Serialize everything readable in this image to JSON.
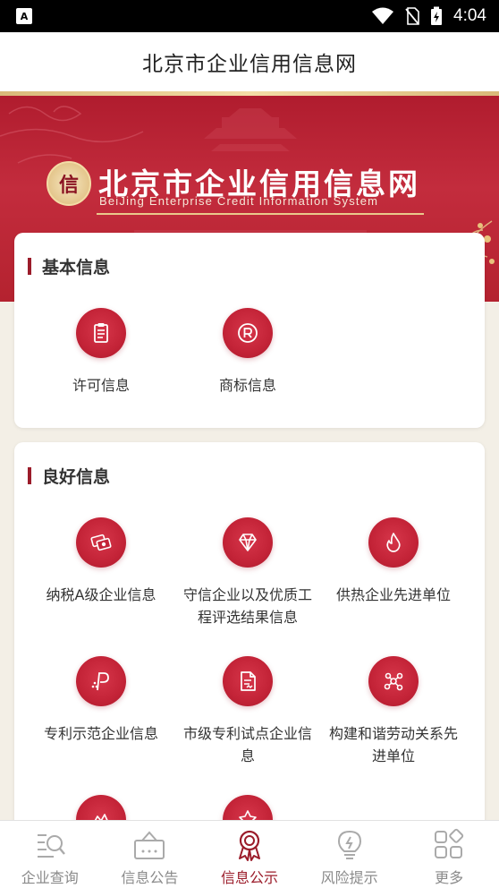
{
  "status_bar": {
    "time": "4:04",
    "notification_icon": "A"
  },
  "header": {
    "title": "北京市企业信用信息网"
  },
  "banner": {
    "seal_char": "信",
    "title": "北京市企业信用信息网",
    "subtitle": "BeiJing Enterprise Credit Information System"
  },
  "basic_info": {
    "title": "基本信息",
    "items": [
      {
        "label": "许可信息",
        "icon": "clipboard-icon"
      },
      {
        "label": "商标信息",
        "icon": "trademark-icon"
      }
    ]
  },
  "good_info": {
    "title": "良好信息",
    "items": [
      {
        "label": "纳税A级企业信息",
        "icon": "tax-icon"
      },
      {
        "label": "守信企业以及优质工程评选结果信息",
        "icon": "diamond-icon"
      },
      {
        "label": "供热企业先进单位",
        "icon": "flame-icon"
      },
      {
        "label": "专利示范企业信息",
        "icon": "patent-icon"
      },
      {
        "label": "市级专利试点企业信息",
        "icon": "document-icon"
      },
      {
        "label": "构建和谐劳动关系先进单位",
        "icon": "network-icon"
      },
      {
        "label": "",
        "icon": "award-icon"
      },
      {
        "label": "",
        "icon": "badge-icon"
      }
    ]
  },
  "bottom_nav": {
    "items": [
      {
        "label": "企业查询",
        "icon": "search-icon"
      },
      {
        "label": "信息公告",
        "icon": "bulletin-icon"
      },
      {
        "label": "信息公示",
        "icon": "ribbon-icon",
        "active": true
      },
      {
        "label": "风险提示",
        "icon": "lightbulb-icon"
      },
      {
        "label": "更多",
        "icon": "grid-icon"
      }
    ]
  },
  "colors": {
    "brand_red": "#9b1c2a",
    "icon_red": "#c32337",
    "gold": "#e9c98b"
  }
}
